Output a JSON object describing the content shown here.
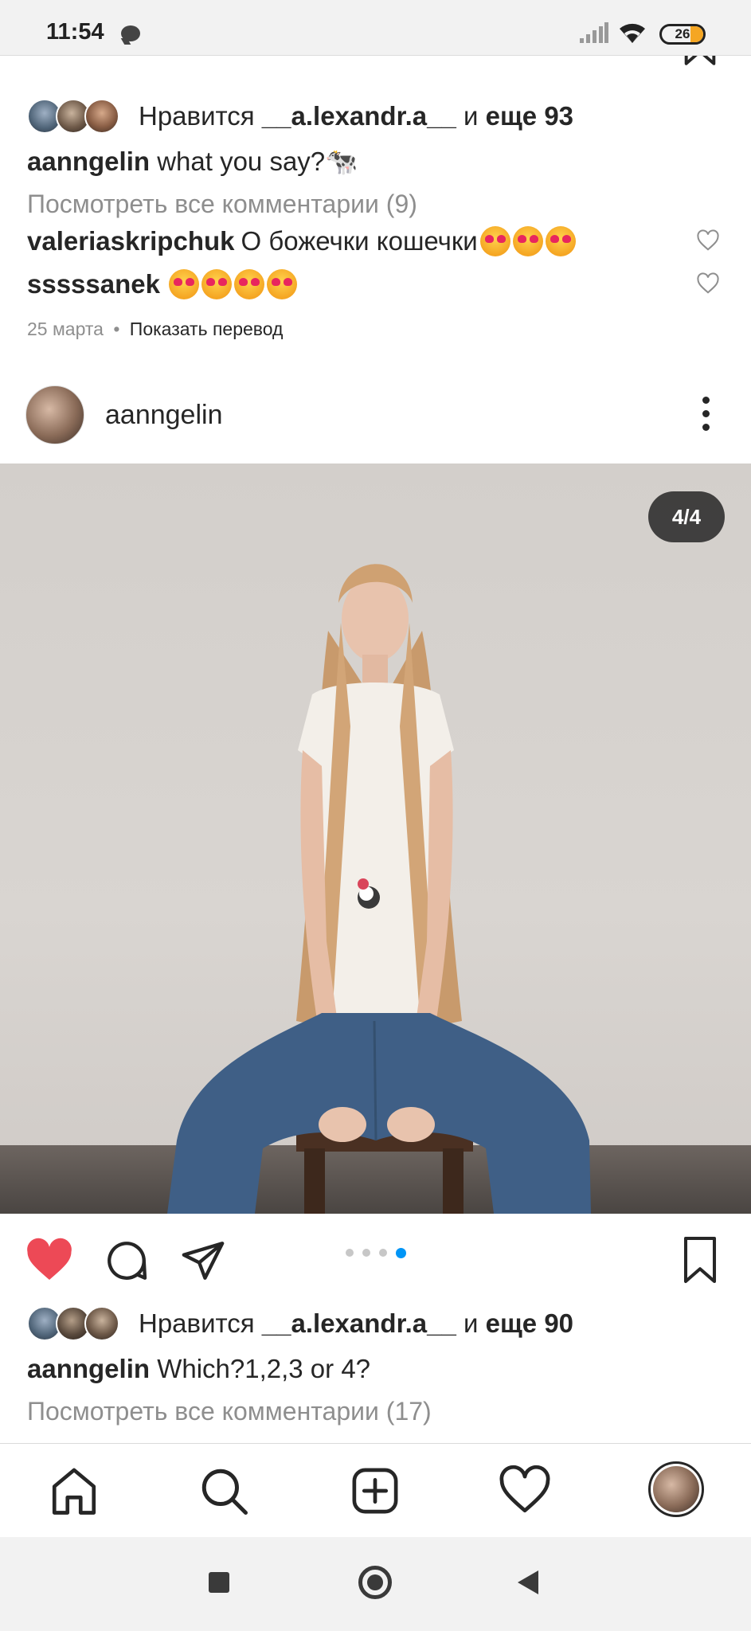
{
  "status_bar": {
    "time": "11:54",
    "battery": "26"
  },
  "post1": {
    "likes": {
      "prefix": "Нравится",
      "user": "__a.lexandr.a__",
      "joiner": "и",
      "more": "еще 93"
    },
    "caption": {
      "user": "aanngelin",
      "text": "what you say?🐄"
    },
    "view_all": "Посмотреть все комментарии (9)",
    "comments": [
      {
        "user": "valeriaskripchuk",
        "text": "О божечки кошечки",
        "emoji_count": 3
      },
      {
        "user": "sssssanek",
        "text": "",
        "emoji_count": 4
      }
    ],
    "date": "25 марта",
    "separator": "•",
    "translate": "Показать перевод"
  },
  "post2": {
    "username": "aanngelin",
    "photo_counter": "4/4",
    "carousel": {
      "total": 4,
      "active": 4
    },
    "likes": {
      "prefix": "Нравится",
      "user": "__a.lexandr.a__",
      "joiner": "и",
      "more": "еще 90"
    },
    "caption": {
      "user": "aanngelin",
      "text": "Which?1,2,3 or 4?"
    },
    "view_all": "Посмотреть все комментарии (17)"
  },
  "bottom_nav": {
    "items": [
      "home-icon",
      "search-icon",
      "new-post-icon",
      "activity-heart-icon",
      "profile-avatar"
    ]
  },
  "colors": {
    "like_red": "#ed4956",
    "carousel_active": "#0095f6",
    "muted_text": "#8e8e8e"
  }
}
